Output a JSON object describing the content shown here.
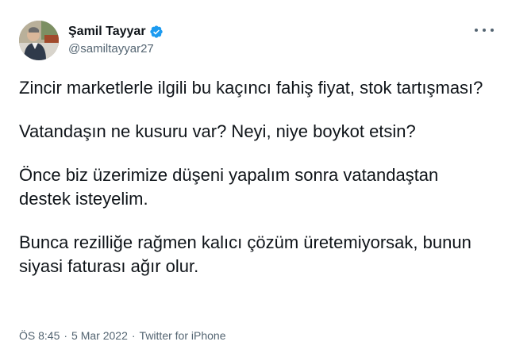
{
  "author": {
    "display_name": "Şamil Tayyar",
    "handle": "@samiltayyar27",
    "verified": true
  },
  "tweet": {
    "paragraphs": [
      "Zincir marketlerle ilgili bu kaçıncı fahiş fiyat, stok tartışması?",
      "Vatandaşın ne kusuru var? Neyi, niye boykot etsin?",
      "Önce biz üzerimize düşeni yapalım sonra vatandaştan destek isteyelim.",
      "Bunca rezilliğe rağmen kalıcı çözüm üretemiyorsak, bunun siyasi faturası ağır olur."
    ],
    "time": "ÖS 8:45",
    "date": "5 Mar 2022",
    "source": "Twitter for iPhone",
    "separator": "·"
  },
  "colors": {
    "verified_blue": "#1d9bf0",
    "text_primary": "#0f1419",
    "text_secondary": "#536471"
  },
  "icons": {
    "more": "more-horizontal-icon",
    "verified": "verified-badge-icon"
  }
}
